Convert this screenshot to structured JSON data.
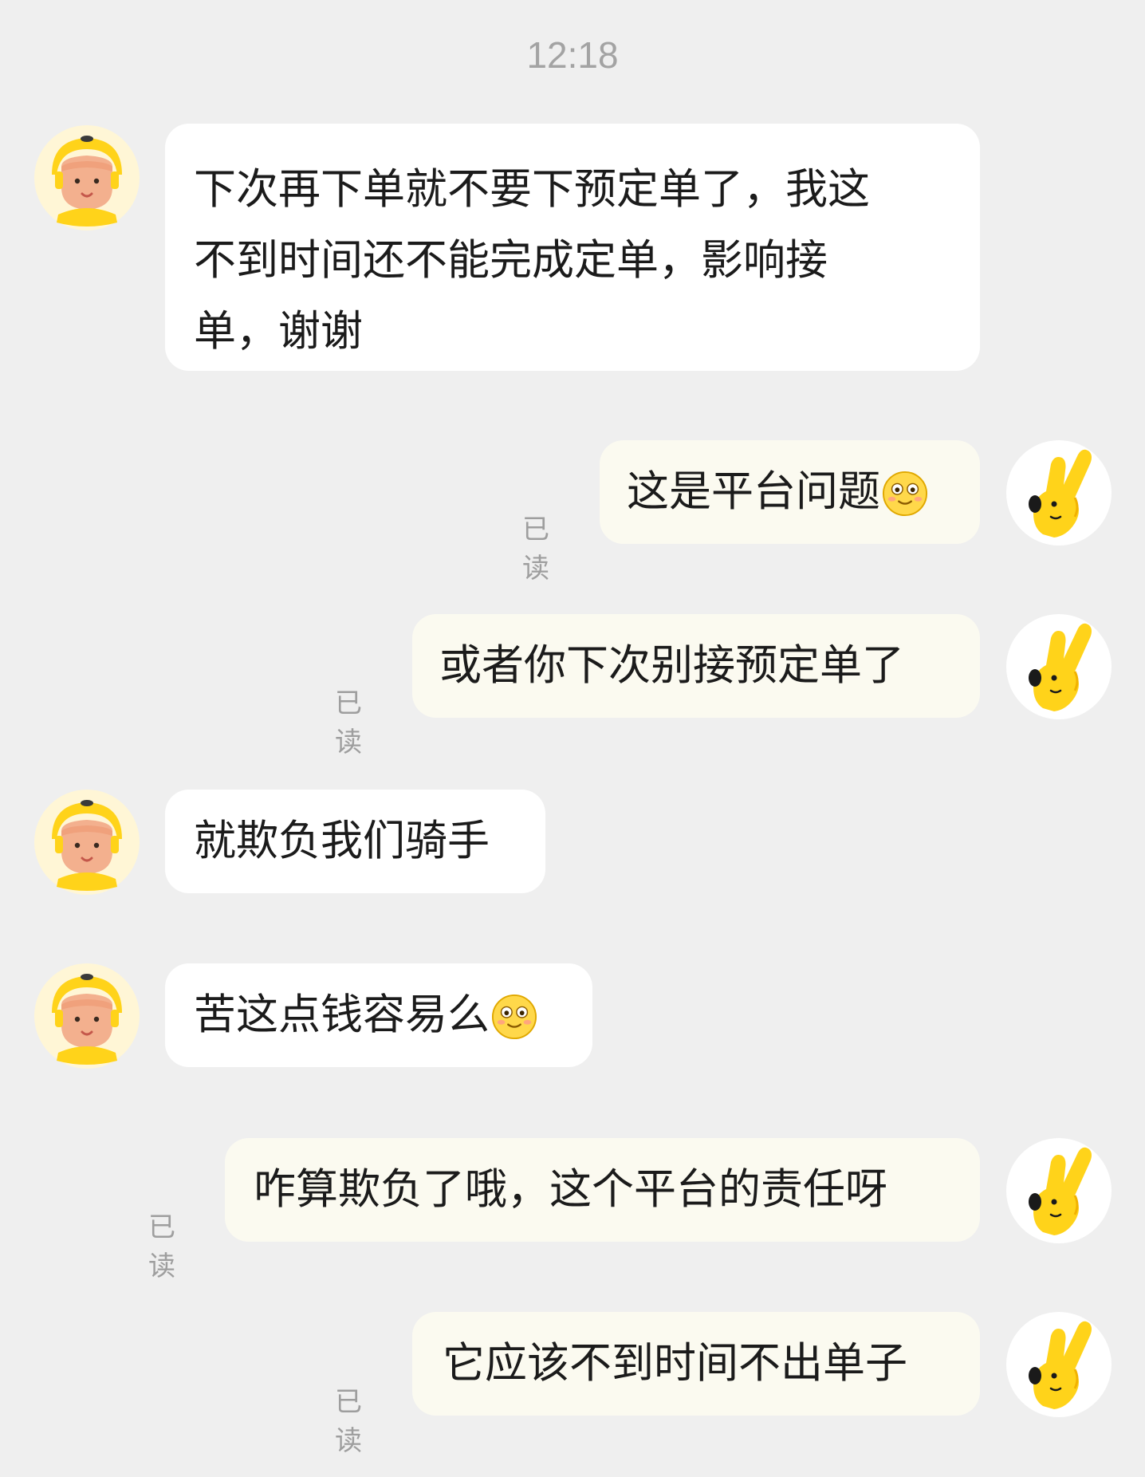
{
  "time": "12:18",
  "read_label": "已读",
  "messages": [
    {
      "text_lines": [
        "下次再下单就不要下预定单了，我这",
        "不到时间还不能完成定单，影响接",
        "单，谢谢"
      ]
    },
    {
      "text": "这是平台问题"
    },
    {
      "text": "或者你下次别接预定单了"
    },
    {
      "text": "就欺负我们骑手"
    },
    {
      "text": "苦这点钱容易么"
    },
    {
      "text": "咋算欺负了哦，这个平台的责任呀"
    },
    {
      "text": "它应该不到时间不出单子"
    }
  ],
  "icons": {
    "incoming_avatar": "rider-avatar-icon",
    "outgoing_avatar": "yellow-hand-mascot-icon",
    "emoji": "blushing-smile-emoji-icon"
  },
  "colors": {
    "background": "#efefef",
    "incoming_bubble": "#ffffff",
    "outgoing_bubble": "#fbfaf0",
    "accent_yellow": "#ffd31a"
  }
}
